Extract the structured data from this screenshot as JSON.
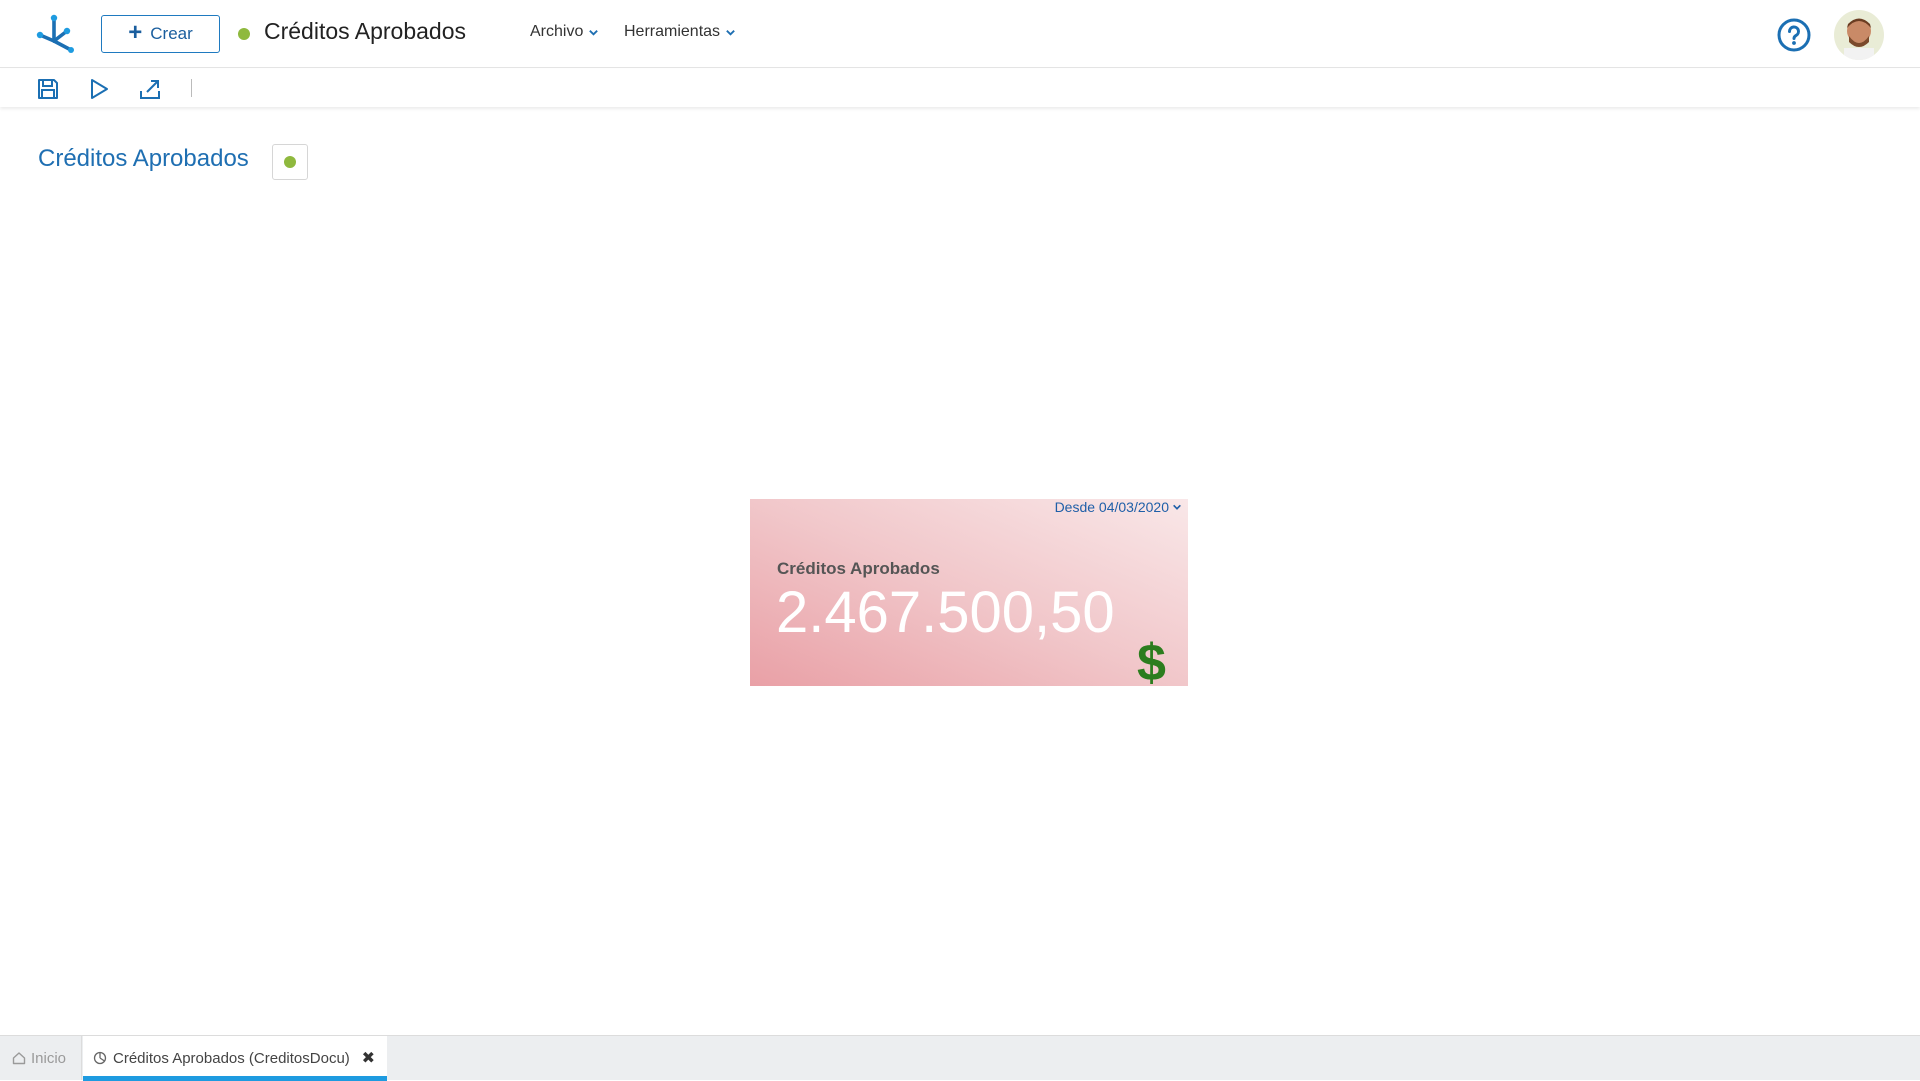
{
  "header": {
    "create_label": "Crear",
    "doc_title": "Créditos Aprobados",
    "menus": [
      {
        "label": "Archivo"
      },
      {
        "label": "Herramientas"
      }
    ],
    "status_color": "#8fb93e",
    "brand_color": "#1f7ac0"
  },
  "toolbar": {
    "icons": [
      "save-icon",
      "play-icon",
      "export-icon"
    ]
  },
  "page": {
    "title": "Créditos Aprobados"
  },
  "card": {
    "date_label": "Desde 04/03/2020",
    "label": "Créditos Aprobados",
    "value": "2.467.500,50",
    "icon": "$",
    "icon_color": "#2c7d1e"
  },
  "tabs": [
    {
      "label": "Inicio",
      "icon": "home-icon"
    },
    {
      "label": "Créditos Aprobados (CreditosDocu)",
      "icon": "chart-icon",
      "active": true
    }
  ]
}
